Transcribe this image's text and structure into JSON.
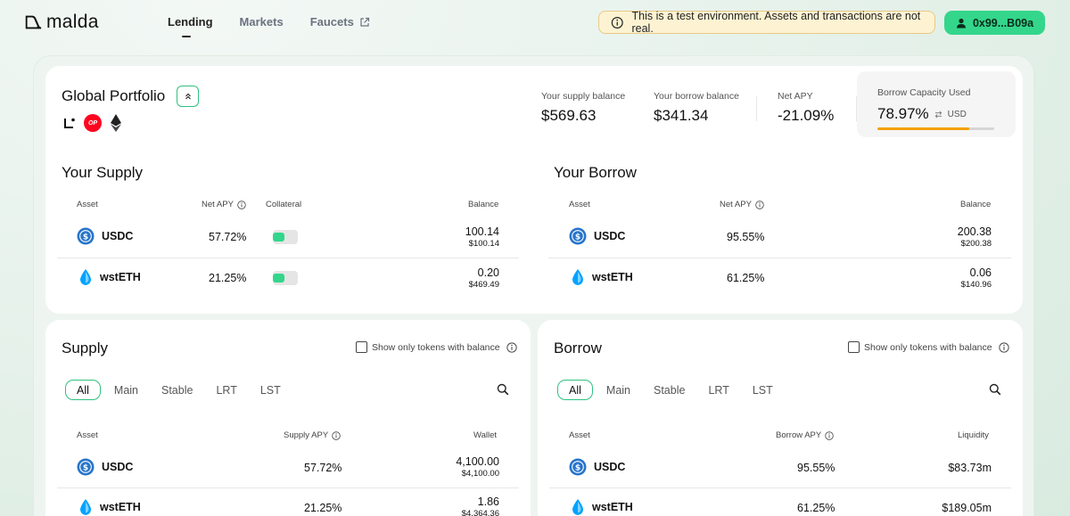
{
  "brand": {
    "name": "malda"
  },
  "nav": [
    {
      "label": "Lending",
      "active": true
    },
    {
      "label": "Markets",
      "active": false
    },
    {
      "label": "Faucets",
      "active": false,
      "external": true
    }
  ],
  "banner": {
    "text": "This is a test environment. Assets and transactions are not real."
  },
  "wallet": {
    "label": "0x99...B09a"
  },
  "portfolio": {
    "title": "Global Portfolio",
    "chains": [
      "linea-icon",
      "optimism-icon",
      "ethereum-icon"
    ],
    "chain_op_text": "OP",
    "stats": {
      "supply_label": "Your supply balance",
      "supply_value": "$569.63",
      "borrow_label": "Your borrow balance",
      "borrow_value": "$341.34",
      "apy_label": "Net APY",
      "apy_value": "-21.09%",
      "cap_label": "Borrow Capacity Used",
      "cap_value": "78.97%",
      "cap_unit": "USD",
      "cap_percent": 78.97
    },
    "your_supply": {
      "title": "Your Supply",
      "headers": {
        "asset": "Asset",
        "apy": "Net APY",
        "collateral": "Collateral",
        "balance": "Balance"
      },
      "rows": [
        {
          "asset": "USDC",
          "apy": "57.72%",
          "balance": "100.14",
          "balance_usd": "$100.14",
          "collateral": true
        },
        {
          "asset": "wstETH",
          "apy": "21.25%",
          "balance": "0.20",
          "balance_usd": "$469.49",
          "collateral": true
        }
      ]
    },
    "your_borrow": {
      "title": "Your Borrow",
      "headers": {
        "asset": "Asset",
        "apy": "Net APY",
        "balance": "Balance"
      },
      "rows": [
        {
          "asset": "USDC",
          "apy": "95.55%",
          "balance": "200.38",
          "balance_usd": "$200.38"
        },
        {
          "asset": "wstETH",
          "apy": "61.25%",
          "balance": "0.06",
          "balance_usd": "$140.96"
        }
      ]
    }
  },
  "supply": {
    "title": "Supply",
    "filter_label": "Show only tokens with balance",
    "tabs": [
      "All",
      "Main",
      "Stable",
      "LRT",
      "LST"
    ],
    "headers": {
      "asset": "Asset",
      "apy": "Supply APY",
      "wallet": "Wallet"
    },
    "rows": [
      {
        "asset": "USDC",
        "apy": "57.72%",
        "wallet": "4,100.00",
        "wallet_usd": "$4,100.00"
      },
      {
        "asset": "wstETH",
        "apy": "21.25%",
        "wallet": "1.86",
        "wallet_usd": "$4,364.36"
      }
    ]
  },
  "borrow": {
    "title": "Borrow",
    "filter_label": "Show only tokens with balance",
    "tabs": [
      "All",
      "Main",
      "Stable",
      "LRT",
      "LST"
    ],
    "headers": {
      "asset": "Asset",
      "apy": "Borrow APY",
      "liquidity": "Liquidity"
    },
    "rows": [
      {
        "asset": "USDC",
        "apy": "95.55%",
        "liquidity": "$83.73m"
      },
      {
        "asset": "wstETH",
        "apy": "61.25%",
        "liquidity": "$189.05m"
      }
    ]
  }
}
